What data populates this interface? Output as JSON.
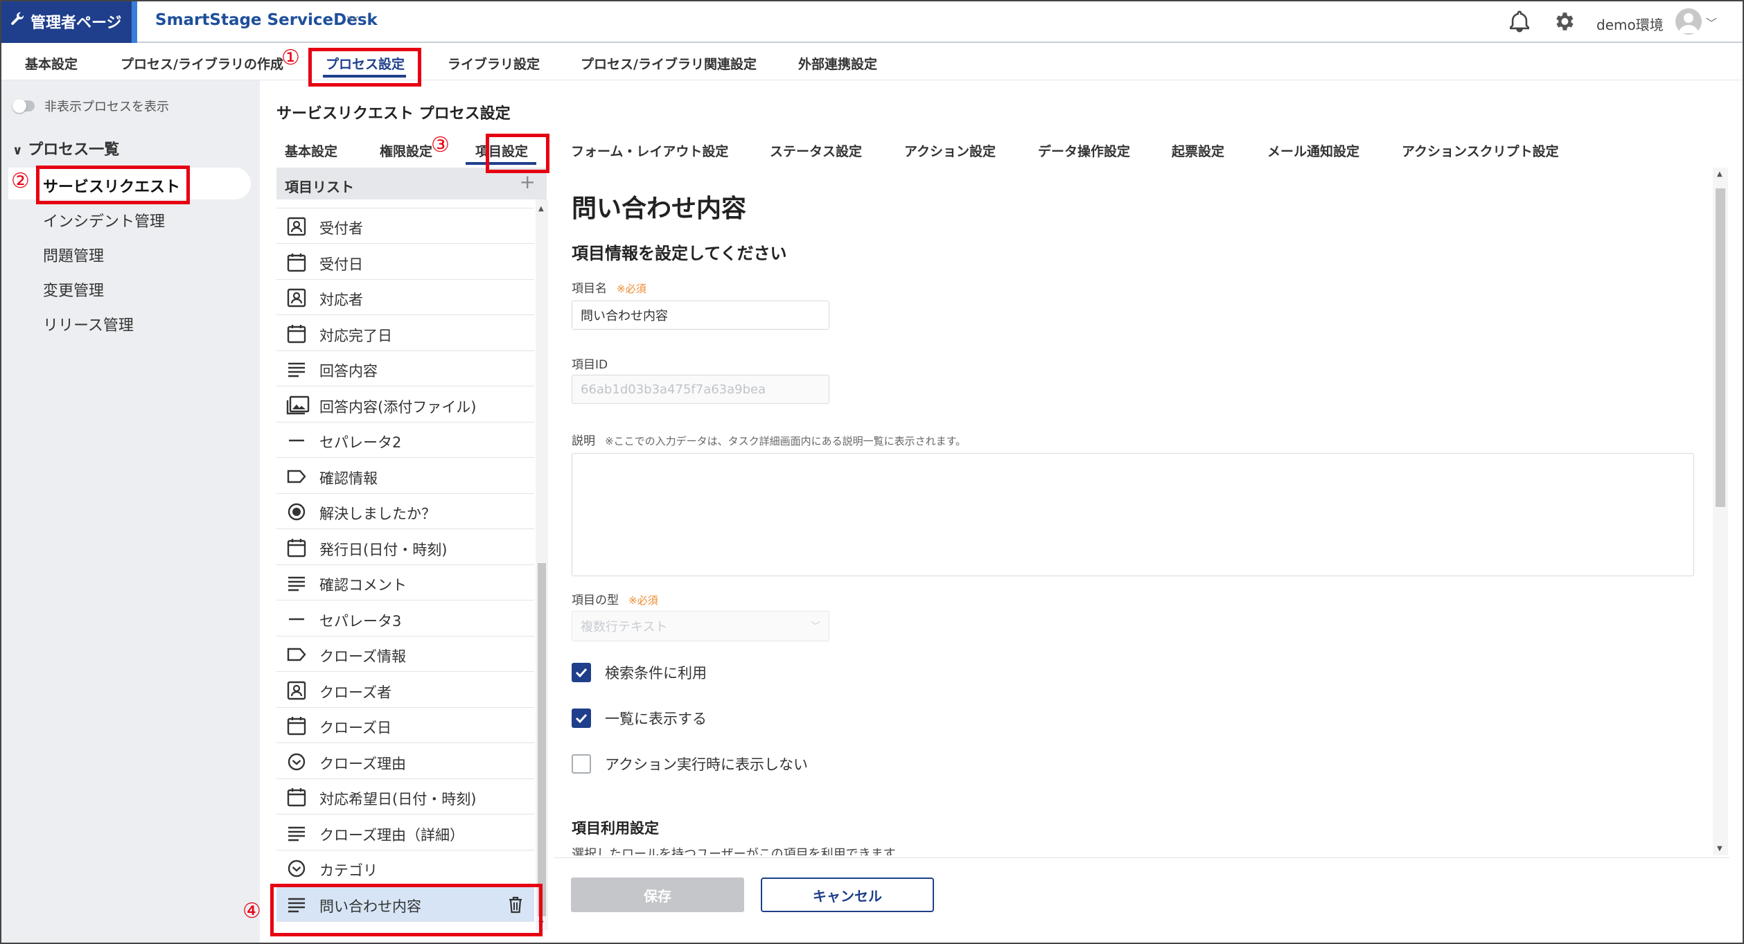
{
  "header": {
    "admin_label": "管理者ページ",
    "app_name": "SmartStage ServiceDesk",
    "env_label": "demo環境"
  },
  "top_tabs": [
    {
      "label": "基本設定"
    },
    {
      "label": "プロセス/ライブラリの作成"
    },
    {
      "label": "プロセス設定",
      "active": true
    },
    {
      "label": "ライブラリ設定"
    },
    {
      "label": "プロセス/ライブラリ関連設定"
    },
    {
      "label": "外部連携設定"
    }
  ],
  "sidebar": {
    "toggle_label": "非表示プロセスを表示",
    "section_label": "プロセス一覧",
    "items": [
      {
        "label": "サービスリクエスト",
        "active": true
      },
      {
        "label": "インシデント管理"
      },
      {
        "label": "問題管理"
      },
      {
        "label": "変更管理"
      },
      {
        "label": "リリース管理"
      }
    ]
  },
  "main": {
    "title": "サービスリクエスト プロセス設定",
    "sub_tabs": [
      {
        "label": "基本設定"
      },
      {
        "label": "権限設定"
      },
      {
        "label": "項目設定",
        "active": true
      },
      {
        "label": "フォーム・レイアウト設定"
      },
      {
        "label": "ステータス設定"
      },
      {
        "label": "アクション設定"
      },
      {
        "label": "データ操作設定"
      },
      {
        "label": "起票設定"
      },
      {
        "label": "メール通知設定"
      },
      {
        "label": "アクションスクリプト設定"
      }
    ]
  },
  "item_list": {
    "header": "項目リスト",
    "add_symbol": "+",
    "items": [
      {
        "icon": "person-icon",
        "label": "受付者"
      },
      {
        "icon": "calendar-icon",
        "label": "受付日"
      },
      {
        "icon": "person-icon",
        "label": "対応者"
      },
      {
        "icon": "calendar-icon",
        "label": "対応完了日"
      },
      {
        "icon": "text-lines-icon",
        "label": "回答内容"
      },
      {
        "icon": "image-attachment-icon",
        "label": "回答内容(添付ファイル)"
      },
      {
        "icon": "separator-icon",
        "label": "セパレータ2"
      },
      {
        "icon": "tag-label-icon",
        "label": "確認情報"
      },
      {
        "icon": "radio-icon",
        "label": "解決しましたか？"
      },
      {
        "icon": "calendar-icon",
        "label": "発行日(日付・時刻)"
      },
      {
        "icon": "text-lines-icon",
        "label": "確認コメント"
      },
      {
        "icon": "separator-icon",
        "label": "セパレータ3"
      },
      {
        "icon": "tag-label-icon",
        "label": "クローズ情報"
      },
      {
        "icon": "person-icon",
        "label": "クローズ者"
      },
      {
        "icon": "calendar-icon",
        "label": "クローズ日"
      },
      {
        "icon": "dropdown-circle-icon",
        "label": "クローズ理由"
      },
      {
        "icon": "calendar-icon",
        "label": "対応希望日(日付・時刻)"
      },
      {
        "icon": "text-lines-icon",
        "label": "クローズ理由（詳細）"
      },
      {
        "icon": "dropdown-circle-icon",
        "label": "カテゴリ"
      },
      {
        "icon": "text-lines-icon",
        "label": "問い合わせ内容",
        "selected": true
      }
    ]
  },
  "form": {
    "title": "問い合わせ内容",
    "subtitle": "項目情報を設定してください",
    "item_name_label": "項目名",
    "required_mark": "※必須",
    "item_name_value": "問い合わせ内容",
    "item_id_label": "項目ID",
    "item_id_value": "66ab1d03b3a475f7a63a9bea",
    "desc_label": "説明",
    "desc_note": "※ここでの入力データは、タスク詳細画面内にある説明一覧に表示されます。",
    "type_label": "項目の型",
    "type_value": "複数行テキスト",
    "checkboxes": [
      {
        "label": "検索条件に利用",
        "checked": true
      },
      {
        "label": "一覧に表示する",
        "checked": true
      },
      {
        "label": "アクション実行時に表示しない",
        "checked": false
      }
    ],
    "usage_section": "項目利用設定",
    "usage_text": "選択したロールを持つユーザーがこの項目を利用できます",
    "save_label": "保存",
    "cancel_label": "キャンセル"
  },
  "annotations": [
    "①",
    "②",
    "③",
    "④"
  ],
  "colors": {
    "brand_navy": "#1f3f8c",
    "annotation_red": "#e60012",
    "required_orange": "#f08a2c",
    "selected_row": "#d6e4f5"
  }
}
